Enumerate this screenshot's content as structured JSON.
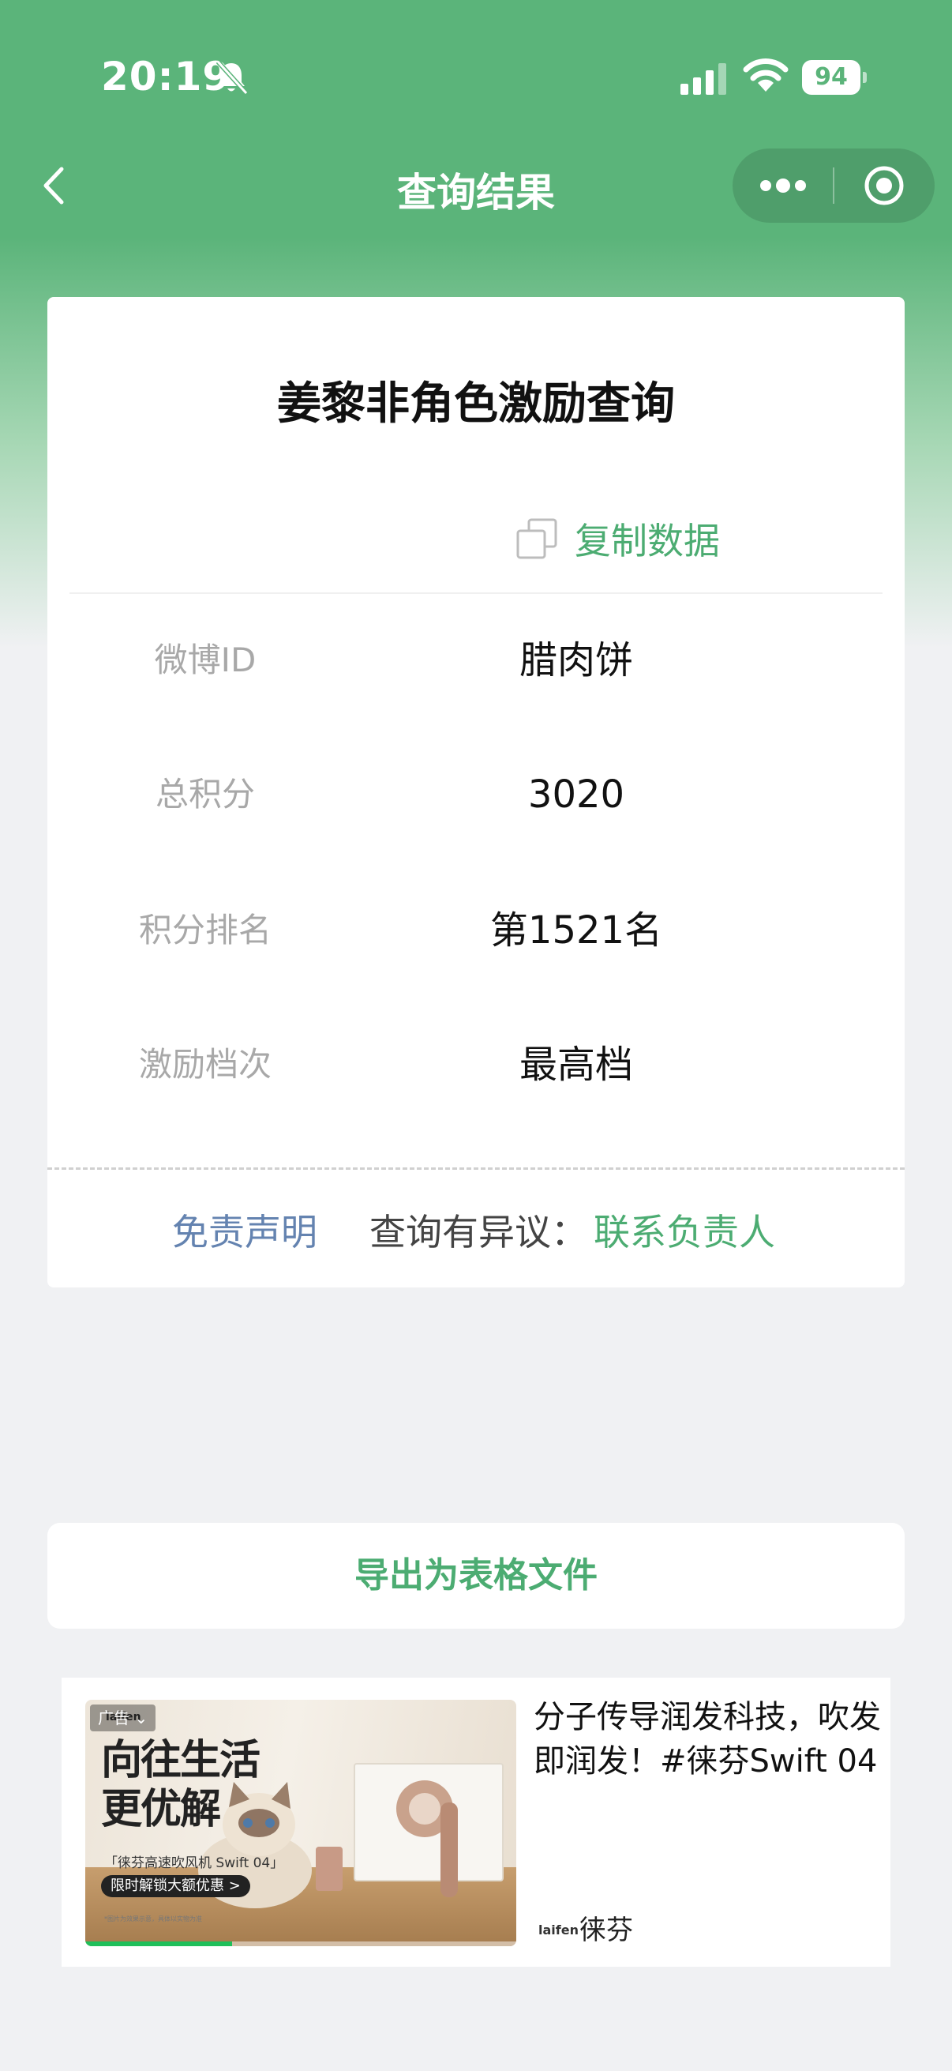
{
  "status_bar": {
    "time": "20:19",
    "battery": "94"
  },
  "nav": {
    "title": "查询结果"
  },
  "card": {
    "title": "姜黎非角色激励查询",
    "copy_label": "复制数据",
    "rows": [
      {
        "label": "微博ID",
        "value": "腊肉饼"
      },
      {
        "label": "总积分",
        "value": "3020"
      },
      {
        "label": "积分排名",
        "value": "第1521名"
      },
      {
        "label": "激励档次",
        "value": "最高档"
      }
    ],
    "disclaimer": "免责声明",
    "dispute_label": "查询有异议：",
    "contact_link": "联系负责人"
  },
  "export_label": "导出为表格文件",
  "ad": {
    "tag": "广告",
    "image_logo": "laifen",
    "headline_line1": "向往生活",
    "headline_line2": "更优解",
    "sub": "「徕芬高速吹风机 Swift 04」",
    "cta": "限时解锁大额优惠 >",
    "fine": "*图片为效果示意，具体以实物为准",
    "progress": 0.34,
    "text": "分子传导润发科技，吹发即润发！#徕芬Swift 04",
    "brand_logo": "laifen",
    "brand_name": "徕芬"
  },
  "colors": {
    "brand_green": "#5bb47a",
    "link_green": "#4cac72",
    "link_blue": "#6483b0",
    "background": "#f0f1f3"
  }
}
